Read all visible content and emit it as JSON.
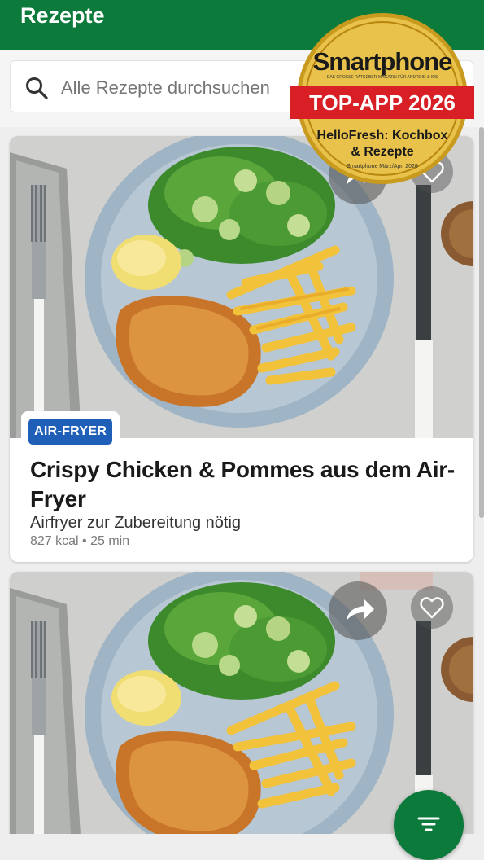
{
  "appbar": {
    "title": "Rezepte"
  },
  "search": {
    "placeholder": "Alle Rezepte durchsuchen"
  },
  "recipes": [
    {
      "tag": "AIR-FRYER",
      "title": "Crispy Chicken & Pommes aus dem Air-Fryer",
      "subtitle": "Airfryer zur Zubereitung nötig",
      "meta": "827 kcal • 25 min"
    },
    {
      "tag": "",
      "title": "",
      "subtitle": "",
      "meta": ""
    }
  ],
  "award": {
    "brand": "Smartphone",
    "tagline": "DAS GROSSE RATGEBER-MAGAZIN FÜR ANDROID & IOS",
    "ribbon": "TOP-APP 2026",
    "app_line1": "HelloFresh: Kochbox",
    "app_line2": "& Rezepte",
    "issue": "Smartphone März/Apr. 2026"
  },
  "icons": {
    "search": "search-icon",
    "share": "share-icon",
    "favorite": "heart-icon",
    "filter": "filter-icon"
  },
  "colors": {
    "brand_green": "#0b7a3b",
    "badge_blue": "#1f5fb8",
    "award_red": "#d81f26",
    "award_gold": "#d4a017"
  }
}
